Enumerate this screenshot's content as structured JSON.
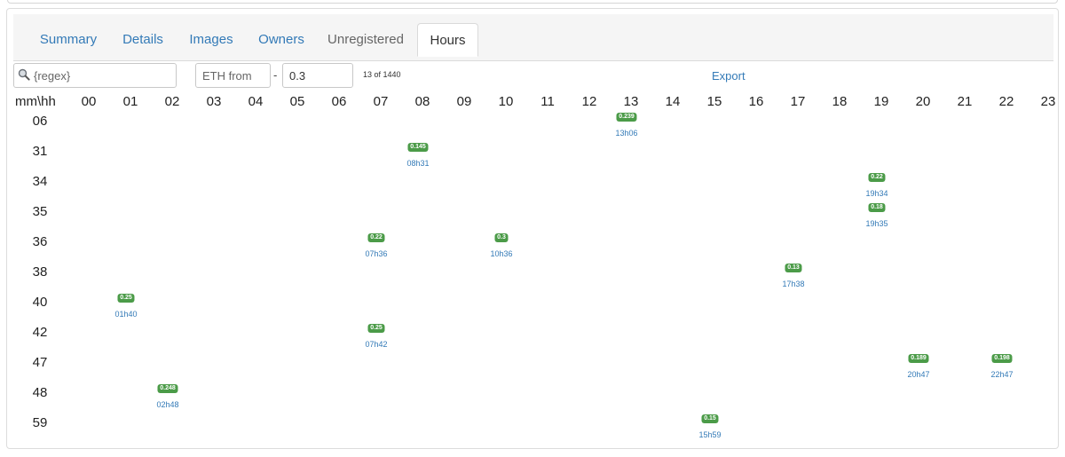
{
  "tabs": [
    {
      "label": "Summary",
      "state": "link"
    },
    {
      "label": "Details",
      "state": "link"
    },
    {
      "label": "Images",
      "state": "link"
    },
    {
      "label": "Owners",
      "state": "link"
    },
    {
      "label": "Unregistered",
      "state": "muted"
    },
    {
      "label": "Hours",
      "state": "active"
    }
  ],
  "filters": {
    "search_placeholder": "{regex}",
    "eth_from_placeholder": "ETH from",
    "separator": "-",
    "eth_to_value": "0.3",
    "count_text": "13 of 1440",
    "export_label": "Export"
  },
  "grid": {
    "corner_label": "mm\\hh",
    "hours": [
      "00",
      "01",
      "02",
      "03",
      "04",
      "05",
      "06",
      "07",
      "08",
      "09",
      "10",
      "11",
      "12",
      "13",
      "14",
      "15",
      "16",
      "17",
      "18",
      "19",
      "20",
      "21",
      "22",
      "23"
    ],
    "minutes": [
      "06",
      "31",
      "34",
      "35",
      "36",
      "38",
      "40",
      "42",
      "47",
      "48",
      "59"
    ],
    "entries": [
      {
        "hour": "13",
        "minute": "06",
        "value": "0.239",
        "time": "13h06"
      },
      {
        "hour": "08",
        "minute": "31",
        "value": "0.145",
        "time": "08h31"
      },
      {
        "hour": "19",
        "minute": "34",
        "value": "0.22",
        "time": "19h34"
      },
      {
        "hour": "19",
        "minute": "35",
        "value": "0.18",
        "time": "19h35"
      },
      {
        "hour": "07",
        "minute": "36",
        "value": "0.22",
        "time": "07h36"
      },
      {
        "hour": "10",
        "minute": "36",
        "value": "0.3",
        "time": "10h36"
      },
      {
        "hour": "17",
        "minute": "38",
        "value": "0.13",
        "time": "17h38"
      },
      {
        "hour": "01",
        "minute": "40",
        "value": "0.25",
        "time": "01h40"
      },
      {
        "hour": "07",
        "minute": "42",
        "value": "0.25",
        "time": "07h42"
      },
      {
        "hour": "20",
        "minute": "47",
        "value": "0.189",
        "time": "20h47"
      },
      {
        "hour": "22",
        "minute": "47",
        "value": "0.198",
        "time": "22h47"
      },
      {
        "hour": "02",
        "minute": "48",
        "value": "0.248",
        "time": "02h48"
      },
      {
        "hour": "15",
        "minute": "59",
        "value": "0.15",
        "time": "15h59"
      }
    ]
  },
  "colors": {
    "badge": "#4b9b48",
    "link": "#337ab7"
  },
  "icons": {
    "search": "magnifier-icon"
  }
}
